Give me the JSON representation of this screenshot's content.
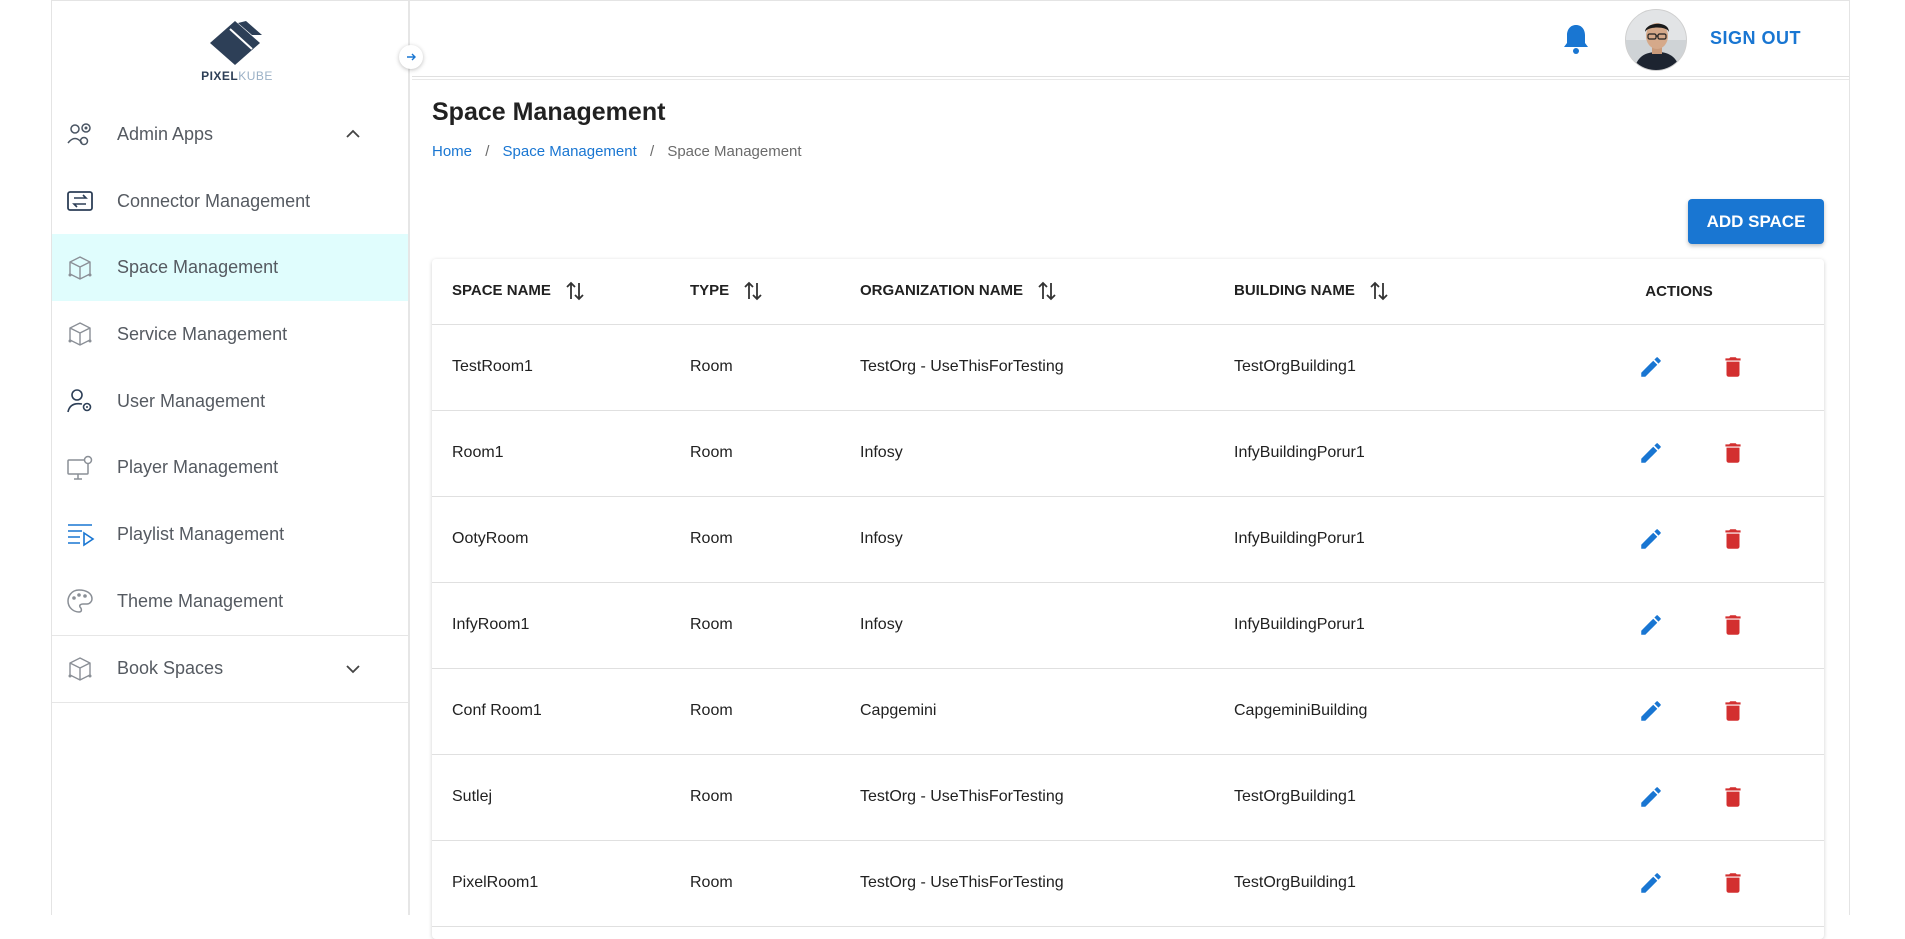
{
  "brand": {
    "logo_bold": "PIXEL",
    "logo_light": "KUBE"
  },
  "colors": {
    "accent": "#1976d2",
    "danger": "#d32f2f",
    "active_nav_bg": "#e0fdfd",
    "logo": "#2d3f57"
  },
  "sidebar": {
    "items": [
      {
        "label": "Admin Apps",
        "icon": "admin-apps-icon",
        "chevron": "chevron-up-icon"
      },
      {
        "label": "Connector Management",
        "icon": "connector-icon"
      },
      {
        "label": "Space Management",
        "icon": "cube-icon",
        "active": true
      },
      {
        "label": "Service Management",
        "icon": "cube-icon"
      },
      {
        "label": "User Management",
        "icon": "user-gear-icon"
      },
      {
        "label": "Player Management",
        "icon": "monitor-gear-icon"
      },
      {
        "label": "Playlist Management",
        "icon": "playlist-icon"
      },
      {
        "label": "Theme Management",
        "icon": "palette-icon"
      },
      {
        "label": "Book Spaces",
        "icon": "cube-icon",
        "chevron": "chevron-down-icon"
      }
    ]
  },
  "header": {
    "sign_out": "SIGN OUT",
    "notification_icon": "bell-icon",
    "avatar_icon": "user-avatar"
  },
  "page": {
    "title": "Space Management",
    "breadcrumb": {
      "home": "Home",
      "parent": "Space Management",
      "current": "Space Management",
      "separator": "/"
    },
    "add_button": "ADD SPACE"
  },
  "table": {
    "columns": [
      "SPACE NAME",
      "TYPE",
      "ORGANIZATION NAME",
      "BUILDING NAME",
      "ACTIONS"
    ],
    "rows": [
      {
        "space": "TestRoom1",
        "type": "Room",
        "org": "TestOrg - UseThisForTesting",
        "building": "TestOrgBuilding1"
      },
      {
        "space": "Room1",
        "type": "Room",
        "org": "Infosy",
        "building": "InfyBuildingPorur1"
      },
      {
        "space": "OotyRoom",
        "type": "Room",
        "org": "Infosy",
        "building": "InfyBuildingPorur1"
      },
      {
        "space": "InfyRoom1",
        "type": "Room",
        "org": "Infosy",
        "building": "InfyBuildingPorur1"
      },
      {
        "space": "Conf Room1",
        "type": "Room",
        "org": "Capgemini",
        "building": "CapgeminiBuilding"
      },
      {
        "space": "Sutlej",
        "type": "Room",
        "org": "TestOrg - UseThisForTesting",
        "building": "TestOrgBuilding1"
      },
      {
        "space": "PixelRoom1",
        "type": "Room",
        "org": "TestOrg - UseThisForTesting",
        "building": "TestOrgBuilding1"
      }
    ]
  }
}
